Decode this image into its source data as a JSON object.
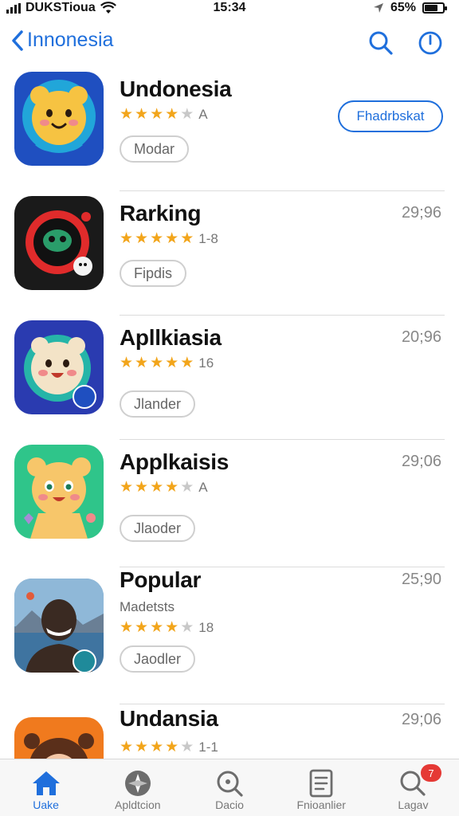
{
  "status_bar": {
    "carrier": "DUKSTioua",
    "time": "15:34",
    "battery_percent": "65%",
    "battery_level": 0.65
  },
  "nav": {
    "back_label": "Innonesia",
    "icons": [
      "search-icon",
      "power-icon"
    ]
  },
  "apps": [
    {
      "name": "Undonesia",
      "rating": 4,
      "rating_label": "A",
      "tag": "Modar",
      "button_label": "Fhadrbskat",
      "icon_theme": "blue-bear",
      "icon_colors": [
        "#1f4fc0",
        "#f6c342"
      ]
    },
    {
      "name": "Rarking",
      "rating": 4.5,
      "rating_label": "1-8",
      "tag": "Fipdis",
      "right_value": "29;96",
      "icon_theme": "dark-camera",
      "icon_colors": [
        "#1a1a1a",
        "#e02b2b"
      ]
    },
    {
      "name": "Apllkiasia",
      "rating": 4.5,
      "rating_label": "16",
      "tag": "Jlander",
      "right_value": "20;96",
      "icon_theme": "blue-bear",
      "icon_colors": [
        "#2a3bb0",
        "#f3e3c7"
      ]
    },
    {
      "name": "Applkaisis",
      "rating": 4,
      "rating_label": "A",
      "tag": "Jlaoder",
      "right_value": "29;06",
      "icon_theme": "green-bear",
      "icon_colors": [
        "#2fc58a",
        "#f7c66a"
      ]
    },
    {
      "name": "Popular",
      "subtitle": "Madetsts",
      "rating": 4,
      "rating_label": "18",
      "tag": "Jaodler",
      "right_value": "25;90",
      "icon_theme": "photo-lake",
      "icon_colors": [
        "#5a8fb8",
        "#3a2a22"
      ]
    },
    {
      "name": "Undansia",
      "rating": 4,
      "rating_label": "1-1",
      "right_value": "29;06",
      "icon_theme": "orange-girl",
      "icon_colors": [
        "#f07a1e",
        "#f4c7a6"
      ]
    }
  ],
  "tab_bar": [
    {
      "label": "Uake",
      "icon": "home-icon",
      "active": true
    },
    {
      "label": "Apldtcion",
      "icon": "compass-icon",
      "active": false
    },
    {
      "label": "Dacio",
      "icon": "magnifier-icon",
      "active": false
    },
    {
      "label": "Fnioanlier",
      "icon": "document-icon",
      "active": false
    },
    {
      "label": "Lagav",
      "icon": "search-icon",
      "active": false,
      "badge": "7"
    }
  ]
}
